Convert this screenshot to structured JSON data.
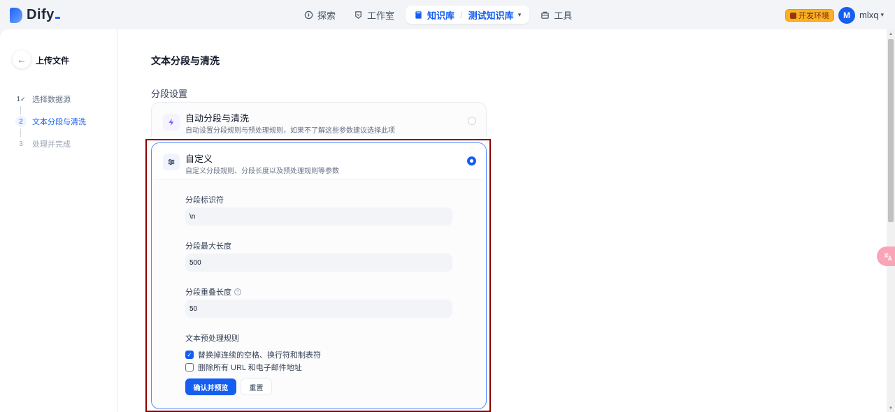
{
  "app": {
    "logo_text": "Dify"
  },
  "nav": {
    "explore": "探索",
    "studio": "工作室",
    "knowledge": "知识库",
    "separator": "/",
    "current_dataset": "测试知识库",
    "tools": "工具"
  },
  "header": {
    "env_badge": "开发环境",
    "avatar_initial": "M",
    "username": "mlxq"
  },
  "sidebar": {
    "back_icon": "←",
    "title": "上传文件",
    "steps": [
      {
        "num": "1",
        "label": "选择数据源"
      },
      {
        "num": "2",
        "label": "文本分段与清洗"
      },
      {
        "num": "3",
        "label": "处理并完成"
      }
    ]
  },
  "main": {
    "title": "文本分段与清洗",
    "section_label": "分段设置",
    "auto_card": {
      "title": "自动分段与清洗",
      "desc": "自动设置分段规则与预处理规则，如果不了解这些参数建议选择此项"
    },
    "custom_card": {
      "title": "自定义",
      "desc": "自定义分段规则、分段长度以及预处理规则等参数",
      "separator_label": "分段标识符",
      "separator_value": "\\n",
      "max_length_label": "分段最大长度",
      "max_length_value": "500",
      "overlap_label": "分段重叠长度",
      "overlap_value": "50",
      "rules_label": "文本预处理规则",
      "rule_1": "替换掉连续的空格、换行符和制表符",
      "rule_1_checked": true,
      "rule_2": "删除所有 URL 和电子邮件地址",
      "rule_2_checked": false,
      "confirm_button": "确认并预览",
      "reset_button": "重置"
    }
  },
  "colors": {
    "accent": "#155eef",
    "highlight_border": "#8b0000",
    "env_badge": "#fdb022"
  }
}
